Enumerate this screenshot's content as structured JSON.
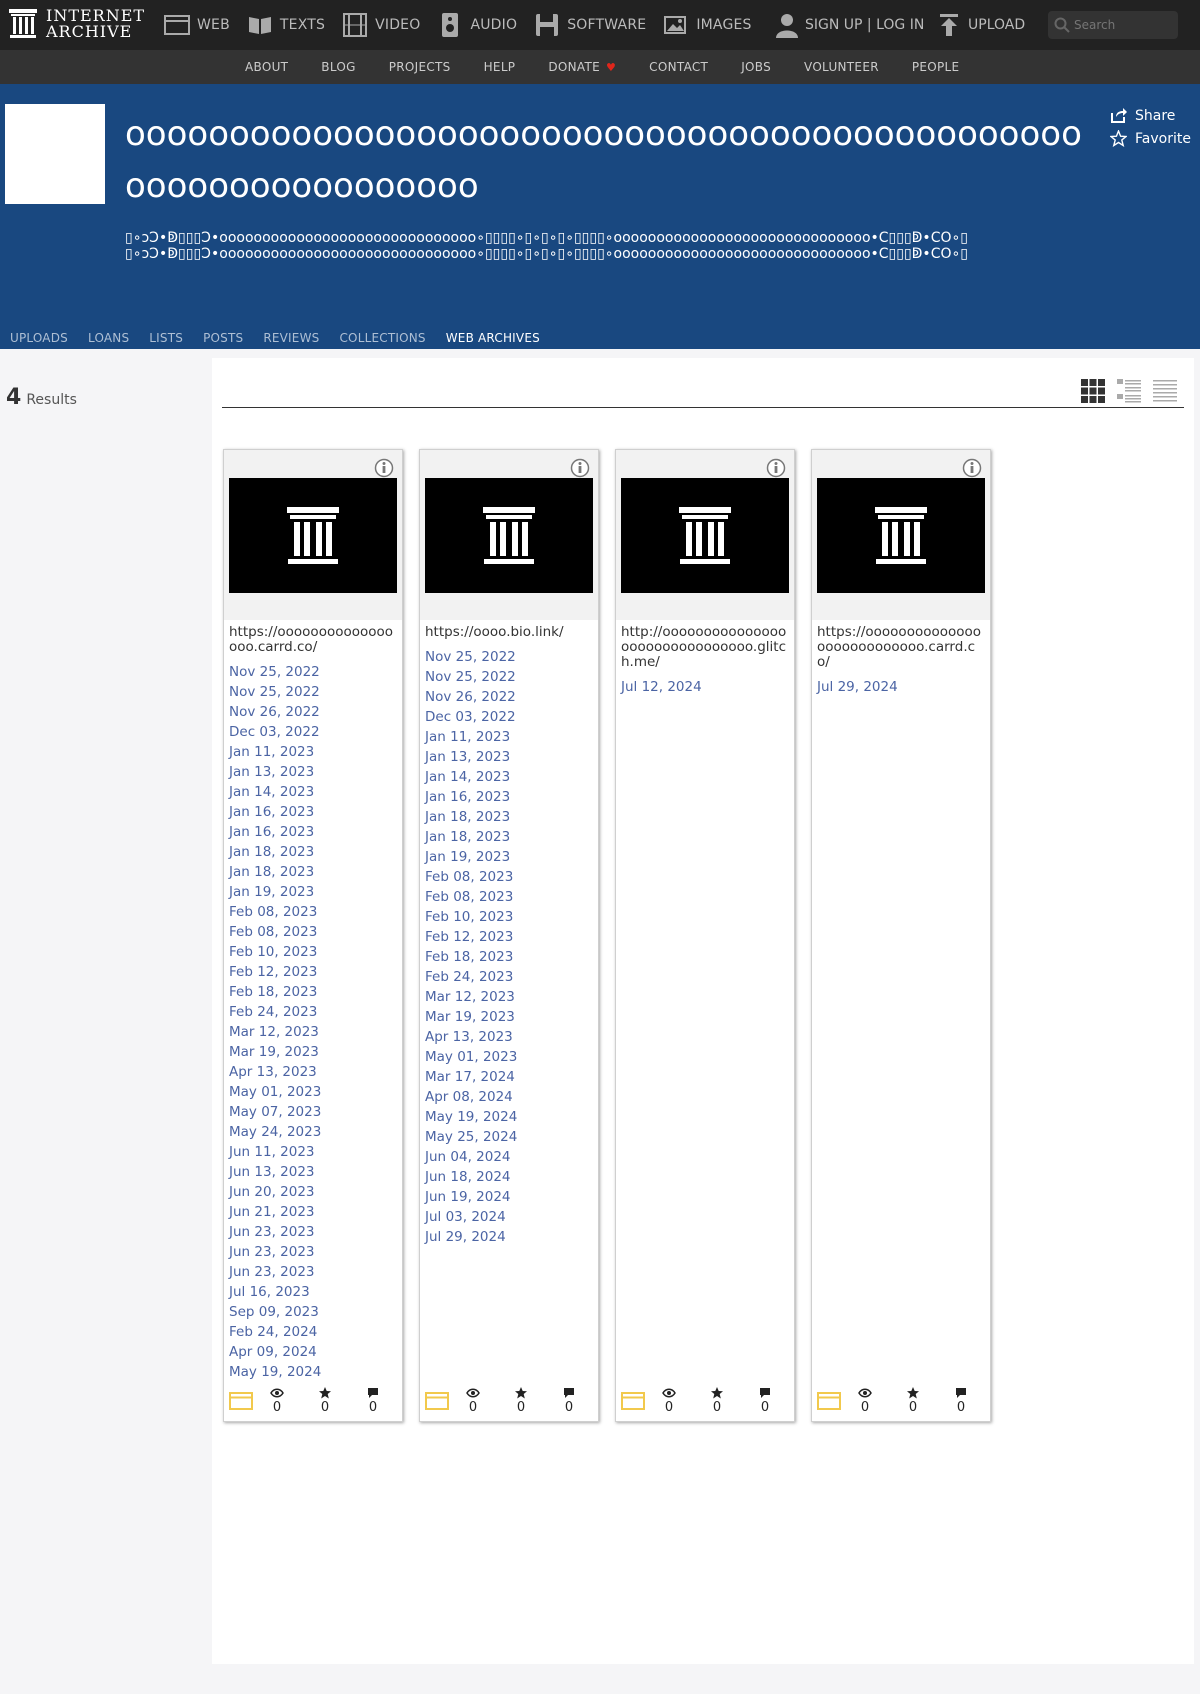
{
  "topnav": {
    "logo_line1": "INTERNET",
    "logo_line2": "ARCHIVE",
    "media": [
      {
        "label": "WEB",
        "icon": "web-icon"
      },
      {
        "label": "TEXTS",
        "icon": "book-icon"
      },
      {
        "label": "VIDEO",
        "icon": "film-icon"
      },
      {
        "label": "AUDIO",
        "icon": "speaker-icon"
      },
      {
        "label": "SOFTWARE",
        "icon": "floppy-icon"
      },
      {
        "label": "IMAGES",
        "icon": "image-icon"
      }
    ],
    "auth_label": "SIGN UP | LOG IN",
    "upload_label": "UPLOAD",
    "search_placeholder": "Search"
  },
  "subnav": {
    "items": [
      "ABOUT",
      "BLOG",
      "PROJECTS",
      "HELP",
      "DONATE",
      "CONTACT",
      "JOBS",
      "VOLUNTEER",
      "PEOPLE"
    ]
  },
  "header": {
    "title": "ooooooooooooooooooooooooooooooooooooooooooooooooooooooooooooooo",
    "description": "▯∘ↄϽ•ↁ▯▯▯Ͻ•oooooooooooooooooooooooooooooo∘▯▯▯▯∘▯∘▯∘▯∘▯▯▯▯∘oooooooooooooooooooooooooooooo•Ϲ▯▯▯ↁ•ϹO∘▯\n▯∘ↄϽ•ↁ▯▯▯Ͻ•oooooooooooooooooooooooooooooo∘▯▯▯▯∘▯∘▯∘▯∘▯▯▯▯∘oooooooooooooooooooooooooooooo•Ϲ▯▯▯ↁ•ϹO∘▯",
    "share_label": "Share",
    "favorite_label": "Favorite",
    "tabs": [
      "UPLOADS",
      "LOANS",
      "LISTS",
      "POSTS",
      "REVIEWS",
      "COLLECTIONS",
      "WEB ARCHIVES"
    ],
    "active_tab": "WEB ARCHIVES"
  },
  "results": {
    "count": "4",
    "label": "Results"
  },
  "tiles": [
    {
      "url": "https://ooooooooooooooooo.carrd.co/",
      "dates": [
        "Nov 25, 2022",
        "Nov 25, 2022",
        "Nov 26, 2022",
        "Dec 03, 2022",
        "Jan 11, 2023",
        "Jan 13, 2023",
        "Jan 14, 2023",
        "Jan 16, 2023",
        "Jan 16, 2023",
        "Jan 18, 2023",
        "Jan 18, 2023",
        "Jan 19, 2023",
        "Feb 08, 2023",
        "Feb 08, 2023",
        "Feb 10, 2023",
        "Feb 12, 2023",
        "Feb 18, 2023",
        "Feb 24, 2023",
        "Mar 12, 2023",
        "Mar 19, 2023",
        "Apr 13, 2023",
        "May 01, 2023",
        "May 07, 2023",
        "May 24, 2023",
        "Jun 11, 2023",
        "Jun 13, 2023",
        "Jun 20, 2023",
        "Jun 21, 2023",
        "Jun 23, 2023",
        "Jun 23, 2023",
        "Jun 23, 2023",
        "Jul 16, 2023",
        "Sep 09, 2023",
        "Feb 24, 2024",
        "Apr 09, 2024",
        "May 19, 2024"
      ],
      "views": "0",
      "favorites": "0",
      "reviews": "0"
    },
    {
      "url": "https://oooo.bio.link/",
      "dates": [
        "Nov 25, 2022",
        "Nov 25, 2022",
        "Nov 26, 2022",
        "Dec 03, 2022",
        "Jan 11, 2023",
        "Jan 13, 2023",
        "Jan 14, 2023",
        "Jan 16, 2023",
        "Jan 18, 2023",
        "Jan 18, 2023",
        "Jan 19, 2023",
        "Feb 08, 2023",
        "Feb 08, 2023",
        "Feb 10, 2023",
        "Feb 12, 2023",
        "Feb 18, 2023",
        "Feb 24, 2023",
        "Mar 12, 2023",
        "Mar 19, 2023",
        "Apr 13, 2023",
        "May 01, 2023",
        "Mar 17, 2024",
        "Apr 08, 2024",
        "May 19, 2024",
        "May 25, 2024",
        "Jun 04, 2024",
        "Jun 18, 2024",
        "Jun 19, 2024",
        "Jul 03, 2024",
        "Jul 29, 2024"
      ],
      "views": "0",
      "favorites": "0",
      "reviews": "0"
    },
    {
      "url": "http://ooooooooooooooooooooooooooooooo.glitch.me/",
      "dates": [
        "Jul 12, 2024"
      ],
      "views": "0",
      "favorites": "0",
      "reviews": "0"
    },
    {
      "url": "https://ooooooooooooooooooooooooooo.carrd.co/",
      "dates": [
        "Jul 29, 2024"
      ],
      "views": "0",
      "favorites": "0",
      "reviews": "0"
    }
  ],
  "colors": {
    "topbar": "#222222",
    "subbar": "#333333",
    "header": "#194880",
    "link": "#4b64a4",
    "web_icon": "#f2c94c"
  }
}
